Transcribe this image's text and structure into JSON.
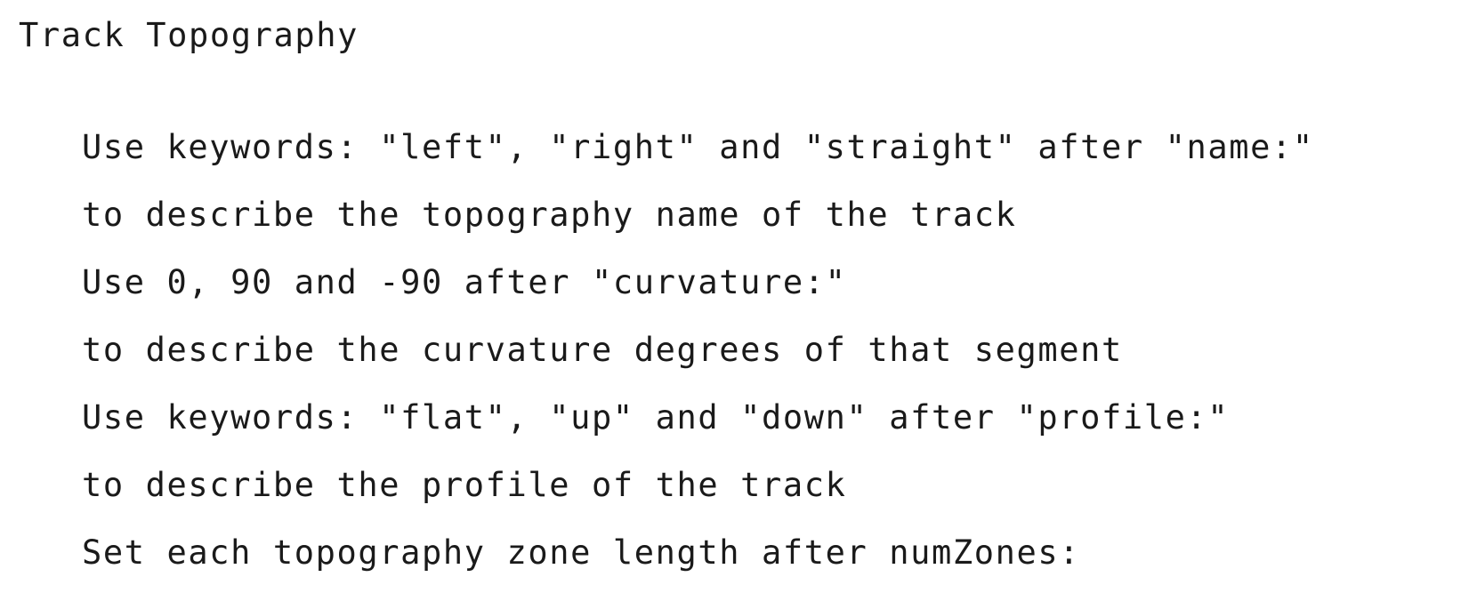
{
  "document": {
    "title": "Track Topography",
    "lines": [
      "Use keywords: \"left\", \"right\" and \"straight\" after \"name:\"",
      "to describe the topography name of the track",
      "Use 0, 90 and -90 after \"curvature:\"",
      "to describe the curvature degrees of that segment",
      "Use keywords: \"flat\", \"up\" and \"down\" after \"profile:\"",
      "to describe the profile of the track",
      "Set each topography zone length after numZones:"
    ]
  }
}
